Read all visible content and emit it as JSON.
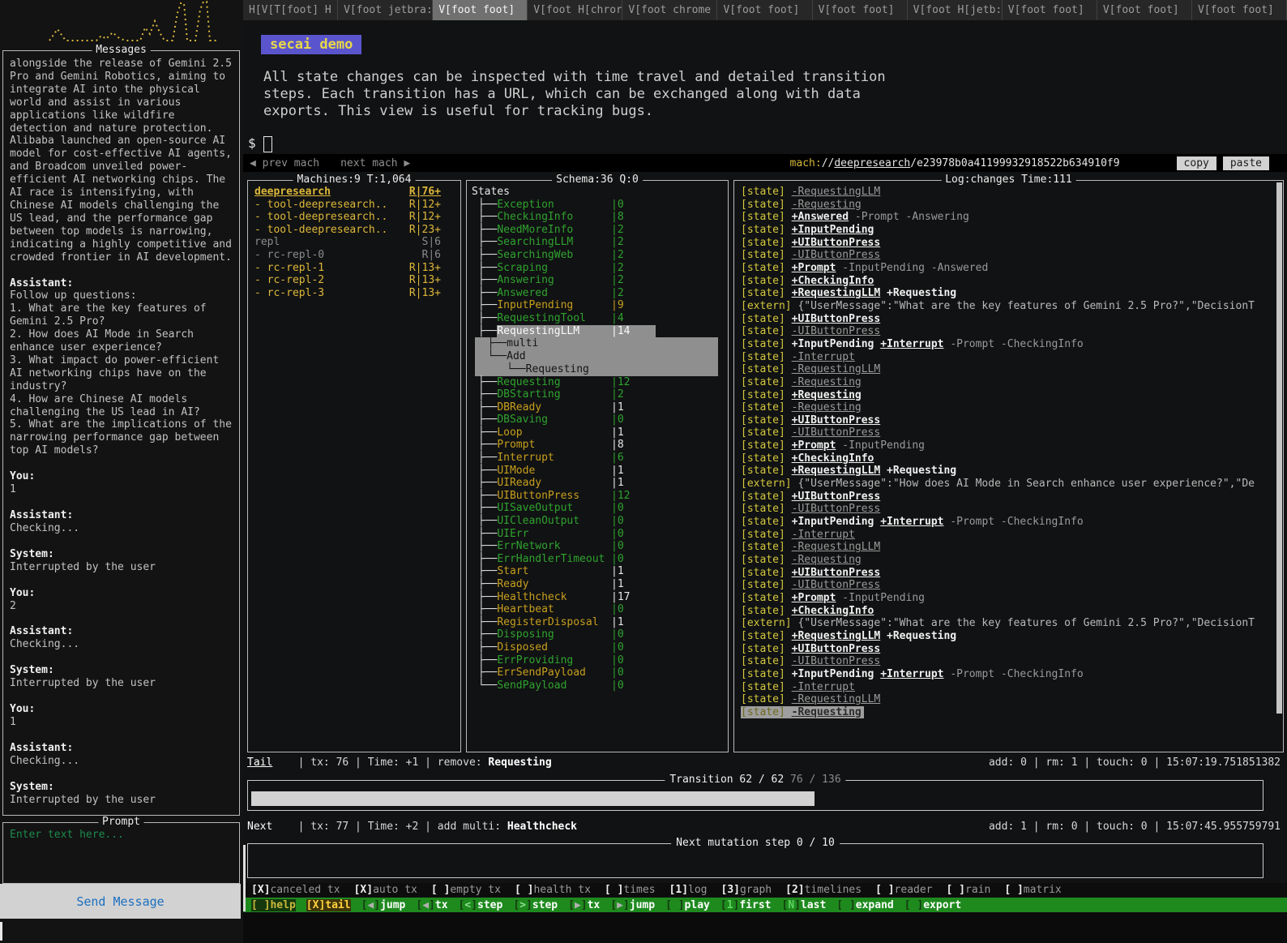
{
  "colors": {
    "accent_yellow": "#ddb83a",
    "state_green": "#2fa32f",
    "state_orange": "#c79f1e",
    "highlight_gray": "#9e9e9e",
    "toolbar_green": "#1e8a1e",
    "badge_purple": "#5a55cd",
    "badge_text_yellow": "#e9d848",
    "send_button_blue": "#1a6fc0",
    "prompt_placeholder_green": "#1d8a4c"
  },
  "tabs": {
    "active_index": 2,
    "items": [
      "H[V[T[foot] H",
      "V[foot jetbra:",
      "V[foot foot]",
      "V[foot H[chror",
      "V[foot chrome",
      "V[foot foot]",
      "V[foot foot]",
      "V[foot H[jetb:",
      "V[foot foot]",
      "V[foot foot]",
      "V[foot foot]"
    ]
  },
  "sidebar": {
    "messages_title": "Messages",
    "messages": [
      {
        "speaker": "",
        "text": "alongside the release of Gemini 2.5\nPro and Gemini Robotics, aiming to\nintegrate AI into the physical\nworld and assist in various\napplications like wildfire\ndetection and nature protection.\nAlibaba launched an open-source AI\nmodel for cost-effective AI agents,\nand Broadcom unveiled power-\nefficient AI networking chips. The\nAI race is intensifying, with\nChinese AI models challenging the\nUS lead, and the performance gap\nbetween top models is narrowing,\nindicating a highly competitive and\ncrowded frontier in AI development."
      },
      {
        "speaker": "Assistant:",
        "text": "Follow up questions:\n1. What are the key features of\nGemini 2.5 Pro?\n2. How does AI Mode in Search\nenhance user experience?\n3. What impact do power-efficient\nAI networking chips have on the\nindustry?\n4. How are Chinese AI models\nchallenging the US lead in AI?\n5. What are the implications of the\nnarrowing performance gap between\ntop AI models?"
      },
      {
        "speaker": "You:",
        "text": "1"
      },
      {
        "speaker": "Assistant:",
        "text": "Checking..."
      },
      {
        "speaker": "System:",
        "text": "Interrupted by the user"
      },
      {
        "speaker": "You:",
        "text": "2"
      },
      {
        "speaker": "Assistant:",
        "text": "Checking..."
      },
      {
        "speaker": "System:",
        "text": "Interrupted by the user"
      },
      {
        "speaker": "You:",
        "text": "1"
      },
      {
        "speaker": "Assistant:",
        "text": "Checking..."
      },
      {
        "speaker": "System:",
        "text": "Interrupted by the user"
      }
    ],
    "prompt_title": "Prompt",
    "prompt_placeholder": "Enter text here...",
    "send_button": "Send Message"
  },
  "hero": {
    "badge": "secai demo",
    "description": "All state changes can be inspected with time travel and detailed transition\nsteps. Each transition has a URL, which can be exchanged along with data\nexports. This view is useful for tracking bugs.",
    "shell_prompt": "$"
  },
  "nav": {
    "prev": "◀ prev mach",
    "next": "next mach ▶",
    "url_scheme": "mach:",
    "url_slashes": "//",
    "url_host": "deepresearch",
    "url_path": "/e23978b0a41199932918522b634910f9",
    "copy": "copy",
    "paste": "paste"
  },
  "machines": {
    "title": "Machines:9 T:1,064",
    "rows": [
      {
        "name": "deepresearch",
        "count": "R|76+",
        "head": true
      },
      {
        "name": "- tool-deepresearch..",
        "count": "R|12+"
      },
      {
        "name": "- tool-deepresearch..",
        "count": "R|12+"
      },
      {
        "name": "- tool-deepresearch..",
        "count": "R|23+"
      },
      {
        "name": "repl",
        "count": "S|6",
        "dim": true
      },
      {
        "name": "- rc-repl-0",
        "count": "R|6",
        "dim": true
      },
      {
        "name": "- rc-repl-1",
        "count": "R|13+"
      },
      {
        "name": "- rc-repl-2",
        "count": "R|13+"
      },
      {
        "name": "- rc-repl-3",
        "count": "R|13+"
      }
    ]
  },
  "states": {
    "title": "Schema:36 Q:0",
    "root": "States",
    "rows": [
      {
        "prefix": " ├──",
        "name": "Exception",
        "count": "0",
        "c": "g"
      },
      {
        "prefix": " ├──",
        "name": "CheckingInfo",
        "count": "8",
        "c": "g"
      },
      {
        "prefix": " ├──",
        "name": "NeedMoreInfo",
        "count": "2",
        "c": "g"
      },
      {
        "prefix": " ├──",
        "name": "SearchingLLM",
        "count": "2",
        "c": "g"
      },
      {
        "prefix": " ├──",
        "name": "SearchingWeb",
        "count": "2",
        "c": "g"
      },
      {
        "prefix": " ├──",
        "name": "Scraping",
        "count": "2",
        "c": "g"
      },
      {
        "prefix": " ├──",
        "name": "Answering",
        "count": "2",
        "c": "g"
      },
      {
        "prefix": " ├──",
        "name": "Answered",
        "count": "2",
        "c": "g"
      },
      {
        "prefix": " ├──",
        "name": "InputPending",
        "count": "9",
        "c": "o",
        "cc": "o"
      },
      {
        "prefix": " ├──",
        "name": "RequestingTool",
        "count": "4",
        "c": "g"
      },
      {
        "prefix": " ├──",
        "name": "RequestingLLM",
        "count": "14",
        "sel": true
      },
      {
        "popup": true,
        "rows": [
          "  ├──multi",
          "  └──Add",
          "     └──Requesting"
        ]
      },
      {
        "prefix": " ├──",
        "name": "Requesting",
        "count": "12",
        "c": "g"
      },
      {
        "prefix": " ├──",
        "name": "DBStarting",
        "count": "2",
        "c": "g"
      },
      {
        "prefix": " ├──",
        "name": "DBReady",
        "count": "1",
        "c": "o",
        "cc": "w"
      },
      {
        "prefix": " ├──",
        "name": "DBSaving",
        "count": "0",
        "c": "g"
      },
      {
        "prefix": " ├──",
        "name": "Loop",
        "count": "1",
        "c": "o",
        "cc": "w"
      },
      {
        "prefix": " ├──",
        "name": "Prompt",
        "count": "8",
        "c": "o",
        "cc": "w"
      },
      {
        "prefix": " ├──",
        "name": "Interrupt",
        "count": "6",
        "c": "o",
        "cc": "g"
      },
      {
        "prefix": " ├──",
        "name": "UIMode",
        "count": "1",
        "c": "o",
        "cc": "w"
      },
      {
        "prefix": " ├──",
        "name": "UIReady",
        "count": "1",
        "c": "o",
        "cc": "w"
      },
      {
        "prefix": " ├──",
        "name": "UIButtonPress",
        "count": "12",
        "c": "o",
        "cc": "g"
      },
      {
        "prefix": " ├──",
        "name": "UISaveOutput",
        "count": "0",
        "c": "g"
      },
      {
        "prefix": " ├──",
        "name": "UICleanOutput",
        "count": "0",
        "c": "g"
      },
      {
        "prefix": " ├──",
        "name": "UIErr",
        "count": "0",
        "c": "g"
      },
      {
        "prefix": " ├──",
        "name": "ErrNetwork",
        "count": "0",
        "c": "g"
      },
      {
        "prefix": " ├──",
        "name": "ErrHandlerTimeout",
        "count": "0",
        "c": "g"
      },
      {
        "prefix": " ├──",
        "name": "Start",
        "count": "1",
        "c": "o",
        "cc": "w"
      },
      {
        "prefix": " ├──",
        "name": "Ready",
        "count": "1",
        "c": "o",
        "cc": "w"
      },
      {
        "prefix": " ├──",
        "name": "Healthcheck",
        "count": "17",
        "c": "o",
        "cc": "w"
      },
      {
        "prefix": " ├──",
        "name": "Heartbeat",
        "count": "0",
        "c": "o",
        "cc": "g"
      },
      {
        "prefix": " ├──",
        "name": "RegisterDisposal",
        "count": "1",
        "c": "o",
        "cc": "w"
      },
      {
        "prefix": " ├──",
        "name": "Disposing",
        "count": "0",
        "c": "g"
      },
      {
        "prefix": " ├──",
        "name": "Disposed",
        "count": "0",
        "c": "o",
        "cc": "g"
      },
      {
        "prefix": " ├──",
        "name": "ErrProviding",
        "count": "0",
        "c": "g"
      },
      {
        "prefix": " ├──",
        "name": "ErrSendPayload",
        "count": "0",
        "c": "o",
        "cc": "g"
      },
      {
        "prefix": " └──",
        "name": "SendPayload",
        "count": "0",
        "c": "g"
      }
    ]
  },
  "log": {
    "title": "Log:changes Time:111",
    "lines": [
      {
        "tag": "state",
        "parts": [
          {
            "t": "-RequestingLLM",
            "s": "ru"
          }
        ]
      },
      {
        "tag": "state",
        "parts": [
          {
            "t": "-Requesting",
            "s": "ru"
          }
        ]
      },
      {
        "tag": "state",
        "parts": [
          {
            "t": "+Answered",
            "s": "au"
          },
          {
            "t": "-Prompt",
            "s": "r"
          },
          {
            "t": "-Answering",
            "s": "r"
          }
        ]
      },
      {
        "tag": "state",
        "parts": [
          {
            "t": "+InputPending",
            "s": "au"
          }
        ]
      },
      {
        "tag": "state",
        "parts": [
          {
            "t": "+UIButtonPress",
            "s": "au"
          }
        ]
      },
      {
        "tag": "state",
        "parts": [
          {
            "t": "-UIButtonPress",
            "s": "ru"
          }
        ]
      },
      {
        "tag": "state",
        "parts": [
          {
            "t": "+Prompt",
            "s": "au"
          },
          {
            "t": "-InputPending",
            "s": "r"
          },
          {
            "t": "-Answered",
            "s": "r"
          }
        ]
      },
      {
        "tag": "state",
        "parts": [
          {
            "t": "+CheckingInfo",
            "s": "au"
          }
        ]
      },
      {
        "tag": "state",
        "parts": [
          {
            "t": "+RequestingLLM",
            "s": "au"
          },
          {
            "t": "+Requesting",
            "s": "a"
          }
        ]
      },
      {
        "tag": "extern",
        "parts": [
          {
            "t": "{\"UserMessage\":\"What are the key features of Gemini 2.5 Pro?\",\"DecisionT",
            "s": "x"
          }
        ]
      },
      {
        "tag": "state",
        "parts": [
          {
            "t": "+UIButtonPress",
            "s": "au"
          }
        ]
      },
      {
        "tag": "state",
        "parts": [
          {
            "t": "-UIButtonPress",
            "s": "ru"
          }
        ]
      },
      {
        "tag": "state",
        "parts": [
          {
            "t": "+InputPending",
            "s": "a"
          },
          {
            "t": "+Interrupt",
            "s": "au"
          },
          {
            "t": "-Prompt",
            "s": "r"
          },
          {
            "t": "-CheckingInfo",
            "s": "r"
          }
        ]
      },
      {
        "tag": "state",
        "parts": [
          {
            "t": "-Interrupt",
            "s": "ru"
          }
        ]
      },
      {
        "tag": "state",
        "parts": [
          {
            "t": "-RequestingLLM",
            "s": "ru"
          }
        ]
      },
      {
        "tag": "state",
        "parts": [
          {
            "t": "-Requesting",
            "s": "ru"
          }
        ]
      },
      {
        "tag": "state",
        "parts": [
          {
            "t": "+Requesting",
            "s": "au"
          }
        ]
      },
      {
        "tag": "state",
        "parts": [
          {
            "t": "-Requesting",
            "s": "ru"
          }
        ]
      },
      {
        "tag": "state",
        "parts": [
          {
            "t": "+UIButtonPress",
            "s": "au"
          }
        ]
      },
      {
        "tag": "state",
        "parts": [
          {
            "t": "-UIButtonPress",
            "s": "ru"
          }
        ]
      },
      {
        "tag": "state",
        "parts": [
          {
            "t": "+Prompt",
            "s": "au"
          },
          {
            "t": "-InputPending",
            "s": "r"
          }
        ]
      },
      {
        "tag": "state",
        "parts": [
          {
            "t": "+CheckingInfo",
            "s": "au"
          }
        ]
      },
      {
        "tag": "state",
        "parts": [
          {
            "t": "+RequestingLLM",
            "s": "au"
          },
          {
            "t": "+Requesting",
            "s": "a"
          }
        ]
      },
      {
        "tag": "extern",
        "parts": [
          {
            "t": "{\"UserMessage\":\"How does AI Mode in Search enhance user experience?\",\"De",
            "s": "x"
          }
        ]
      },
      {
        "tag": "state",
        "parts": [
          {
            "t": "+UIButtonPress",
            "s": "au"
          }
        ]
      },
      {
        "tag": "state",
        "parts": [
          {
            "t": "-UIButtonPress",
            "s": "ru"
          }
        ]
      },
      {
        "tag": "state",
        "parts": [
          {
            "t": "+InputPending",
            "s": "a"
          },
          {
            "t": "+Interrupt",
            "s": "au"
          },
          {
            "t": "-Prompt",
            "s": "r"
          },
          {
            "t": "-CheckingInfo",
            "s": "r"
          }
        ]
      },
      {
        "tag": "state",
        "parts": [
          {
            "t": "-Interrupt",
            "s": "ru"
          }
        ]
      },
      {
        "tag": "state",
        "parts": [
          {
            "t": "-RequestingLLM",
            "s": "ru"
          }
        ]
      },
      {
        "tag": "state",
        "parts": [
          {
            "t": "-Requesting",
            "s": "ru"
          }
        ]
      },
      {
        "tag": "state",
        "parts": [
          {
            "t": "+UIButtonPress",
            "s": "au"
          }
        ]
      },
      {
        "tag": "state",
        "parts": [
          {
            "t": "-UIButtonPress",
            "s": "ru"
          }
        ]
      },
      {
        "tag": "state",
        "parts": [
          {
            "t": "+Prompt",
            "s": "au"
          },
          {
            "t": "-InputPending",
            "s": "r"
          }
        ]
      },
      {
        "tag": "state",
        "parts": [
          {
            "t": "+CheckingInfo",
            "s": "au"
          }
        ]
      },
      {
        "tag": "extern",
        "parts": [
          {
            "t": "{\"UserMessage\":\"What are the key features of Gemini 2.5 Pro?\",\"DecisionT",
            "s": "x"
          }
        ]
      },
      {
        "tag": "state",
        "parts": [
          {
            "t": "+RequestingLLM",
            "s": "au"
          },
          {
            "t": "+Requesting",
            "s": "a"
          }
        ]
      },
      {
        "tag": "state",
        "parts": [
          {
            "t": "+UIButtonPress",
            "s": "au"
          }
        ]
      },
      {
        "tag": "state",
        "parts": [
          {
            "t": "-UIButtonPress",
            "s": "ru"
          }
        ]
      },
      {
        "tag": "state",
        "parts": [
          {
            "t": "+InputPending",
            "s": "a"
          },
          {
            "t": "+Interrupt",
            "s": "au"
          },
          {
            "t": "-Prompt",
            "s": "r"
          },
          {
            "t": "-CheckingInfo",
            "s": "r"
          }
        ]
      },
      {
        "tag": "state",
        "parts": [
          {
            "t": "-Interrupt",
            "s": "ru"
          }
        ]
      },
      {
        "tag": "state",
        "parts": [
          {
            "t": "-RequestingLLM",
            "s": "ru"
          }
        ]
      },
      {
        "tag": "state",
        "parts": [
          {
            "t": "-Requesting",
            "s": "ru"
          }
        ],
        "hl": true
      }
    ]
  },
  "tail": {
    "label": "Tail",
    "info": "    | tx: 76 | Time: +1 | remove: ",
    "strong": "Requesting",
    "right": "add: 0 | rm: 1 | touch: 0 | 15:07:19.751851382"
  },
  "transition": {
    "title_main": "Transition 62 / 62",
    "title_dim": " 76 / 136",
    "percent": 55.9
  },
  "next": {
    "label": "Next",
    "info": "    | tx: 77 | Time: +2 | add multi: ",
    "strong": "Healthcheck",
    "right": "add: 1 | rm: 0 | touch: 0 | 15:07:45.955759791"
  },
  "mutation": {
    "title": "Next mutation step 0 / 10",
    "percent": 0
  },
  "toolbar": {
    "row1": [
      {
        "k": "X",
        "label": "canceled tx"
      },
      {
        "k": "X",
        "label": "auto tx"
      },
      {
        "k": " ",
        "label": "empty tx"
      },
      {
        "k": " ",
        "label": "health tx"
      },
      {
        "k": " ",
        "label": "times"
      },
      {
        "k": "1",
        "label": "log"
      },
      {
        "k": "3",
        "label": "graph"
      },
      {
        "k": "2",
        "label": "timelines"
      },
      {
        "k": " ",
        "label": "reader"
      },
      {
        "k": " ",
        "label": "rain"
      },
      {
        "k": " ",
        "label": "matrix"
      }
    ],
    "row2": [
      {
        "k": " ",
        "label": "help",
        "cls": "help"
      },
      {
        "k": "X",
        "label": "tail",
        "cls": "tail"
      },
      {
        "k": "◀",
        "label": "jump",
        "kc": "arrow"
      },
      {
        "k": "◀",
        "label": "tx",
        "kc": "arrow"
      },
      {
        "k": "<",
        "label": "step",
        "kc": "lt"
      },
      {
        "k": ">",
        "label": "step",
        "kc": "lt"
      },
      {
        "k": "▶",
        "label": "tx",
        "kc": "arrow"
      },
      {
        "k": "▶",
        "label": "jump",
        "kc": "arrow"
      },
      {
        "k": " ",
        "label": "play"
      },
      {
        "k": "1",
        "label": "first",
        "kc": "num"
      },
      {
        "k": "N",
        "label": "last",
        "kc": "num"
      },
      {
        "k": " ",
        "label": "expand"
      },
      {
        "k": " ",
        "label": "export"
      }
    ]
  }
}
